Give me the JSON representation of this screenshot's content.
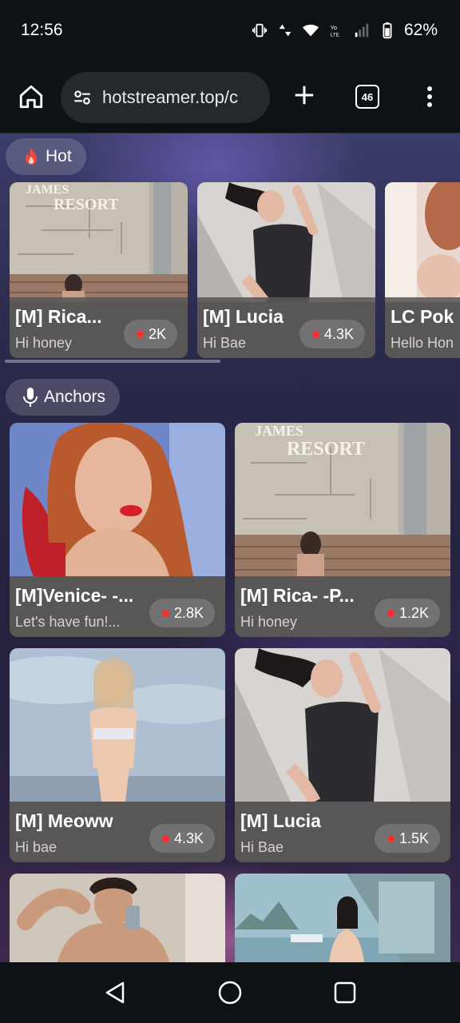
{
  "status_bar": {
    "time": "12:56",
    "battery": "62%"
  },
  "browser": {
    "url": "hotstreamer.top/c",
    "tab_count": "46"
  },
  "sections": {
    "hot": {
      "label": "Hot"
    },
    "anchors": {
      "label": "Anchors"
    }
  },
  "hot_cards": [
    {
      "name": "[M] Rica...",
      "message": "Hi honey",
      "viewers": "2K"
    },
    {
      "name": "[M] Lucia",
      "message": "Hi Bae",
      "viewers": "4.3K"
    },
    {
      "name": "LC Pok",
      "message": "Hello Hon",
      "viewers": ""
    }
  ],
  "anchor_cards": [
    {
      "name": "[M]Venice- -...",
      "message": "Let's have fun!...",
      "viewers": "2.8K"
    },
    {
      "name": "[M] Rica- -P...",
      "message": "Hi honey",
      "viewers": "1.2K"
    },
    {
      "name": "[M] Meoww",
      "message": "Hi bae",
      "viewers": "4.3K"
    },
    {
      "name": "[M] Lucia",
      "message": "Hi Bae",
      "viewers": "1.5K"
    }
  ],
  "photo_texts": {
    "resort_sign": "RESORT",
    "resort_sign_top": "JAMES"
  },
  "colors": {
    "live_dot": "#ff2d2d",
    "chip_bg": "#ffffff29",
    "flame": "#f04b3a"
  }
}
